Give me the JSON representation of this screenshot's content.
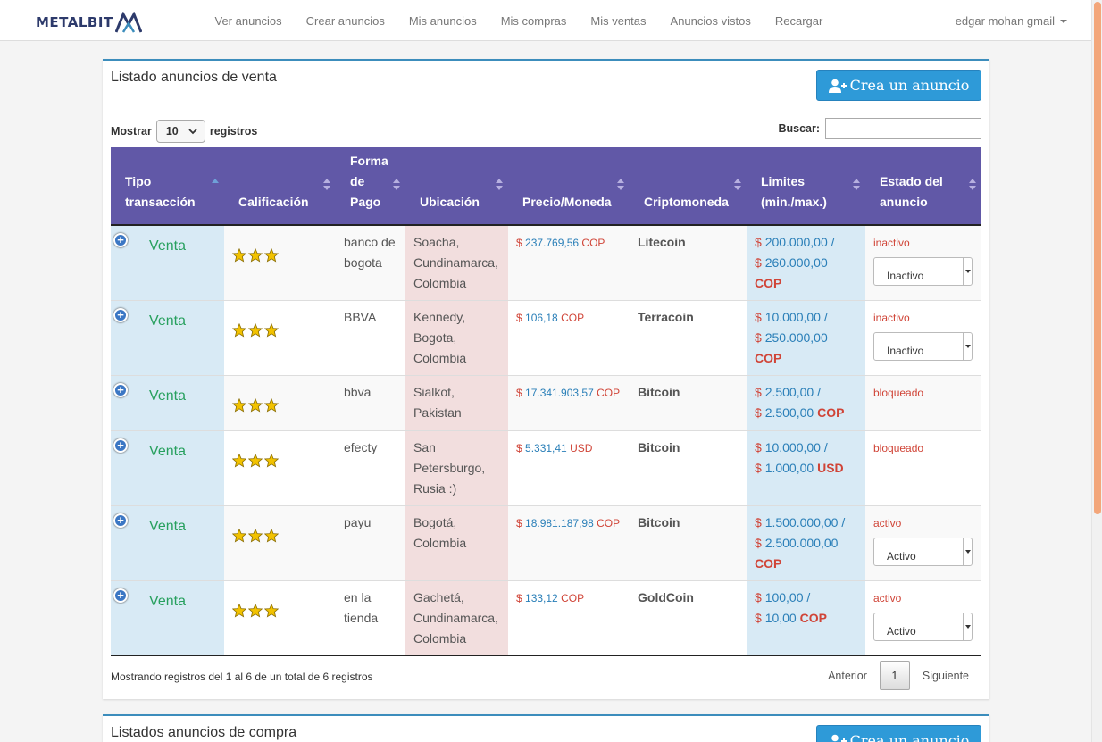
{
  "navbar": {
    "logo_text": "METALBIT",
    "links": [
      "Ver anuncios",
      "Crear anuncios",
      "Mis anuncios",
      "Mis compras",
      "Mis ventas",
      "Anuncios vistos",
      "Recargar"
    ],
    "user": "edgar mohan gmail"
  },
  "sell_panel": {
    "title": "Listado anuncios de venta",
    "create_label": "Crea un anuncio",
    "length_prefix": "Mostrar",
    "length_value": "10",
    "length_suffix": "registros",
    "search_label": "Buscar:",
    "search_value": "",
    "headers": [
      "Tipo transacción",
      "Calificación",
      "Forma de Pago",
      "Ubicación",
      "Precio/Moneda",
      "Criptomoneda",
      "Limites (min./max.)",
      "Estado del anuncio"
    ],
    "rows": [
      {
        "tipo": "Venta",
        "stars": 3,
        "pago": "banco de bogota",
        "ubicacion": "Soacha, Cundinamarca, Colombia",
        "precio": "237.769,56",
        "moneda": "COP",
        "crypto": "Litecoin",
        "lim_min": "200.000,00",
        "lim_max": "260.000,00",
        "lim_cur": "COP",
        "estado": "inactivo",
        "select": "Inactivo"
      },
      {
        "tipo": "Venta",
        "stars": 3,
        "pago": "BBVA",
        "ubicacion": "Kennedy, Bogota, Colombia",
        "precio": "106,18",
        "moneda": "COP",
        "crypto": "Terracoin",
        "lim_min": "10.000,00",
        "lim_max": "250.000,00",
        "lim_cur": "COP",
        "estado": "inactivo",
        "select": "Inactivo"
      },
      {
        "tipo": "Venta",
        "stars": 3,
        "pago": "bbva",
        "ubicacion": "Sialkot, Pakistan",
        "precio": "17.341.903,57",
        "moneda": "COP",
        "crypto": "Bitcoin",
        "lim_min": "2.500,00",
        "lim_max": "2.500,00",
        "lim_cur": "COP",
        "estado": "bloqueado",
        "select": ""
      },
      {
        "tipo": "Venta",
        "stars": 3,
        "pago": "efecty",
        "ubicacion": "San Petersburgo, Rusia :)",
        "precio": "5.331,41",
        "moneda": "USD",
        "crypto": "Bitcoin",
        "lim_min": "10.000,00",
        "lim_max": "1.000,00",
        "lim_cur": "USD",
        "estado": "bloqueado",
        "select": ""
      },
      {
        "tipo": "Venta",
        "stars": 3,
        "pago": "payu",
        "ubicacion": "Bogotá, Colombia",
        "precio": "18.981.187,98",
        "moneda": "COP",
        "crypto": "Bitcoin",
        "lim_min": "1.500.000,00",
        "lim_max": "2.500.000,00",
        "lim_cur": "COP",
        "estado": "activo",
        "select": "Activo"
      },
      {
        "tipo": "Venta",
        "stars": 3,
        "pago": "en la tienda",
        "ubicacion": "Gachetá, Cundinamarca, Colombia",
        "precio": "133,12",
        "moneda": "COP",
        "crypto": "GoldCoin",
        "lim_min": "100,00",
        "lim_max": "10,00",
        "lim_cur": "COP",
        "estado": "activo",
        "select": "Activo"
      }
    ],
    "info": "Mostrando registros del 1 al 6 de un total de 6 registros",
    "pager": {
      "prev": "Anterior",
      "current": "1",
      "next": "Siguiente"
    }
  },
  "buy_panel": {
    "title": "Listados anuncios de compra",
    "create_label": "Crea un anuncio"
  },
  "colors": {
    "header": "#6158a7",
    "accent": "#2e9ad8",
    "venta": "#27a05e",
    "danger": "#d04437",
    "link": "#2a7fb8"
  }
}
